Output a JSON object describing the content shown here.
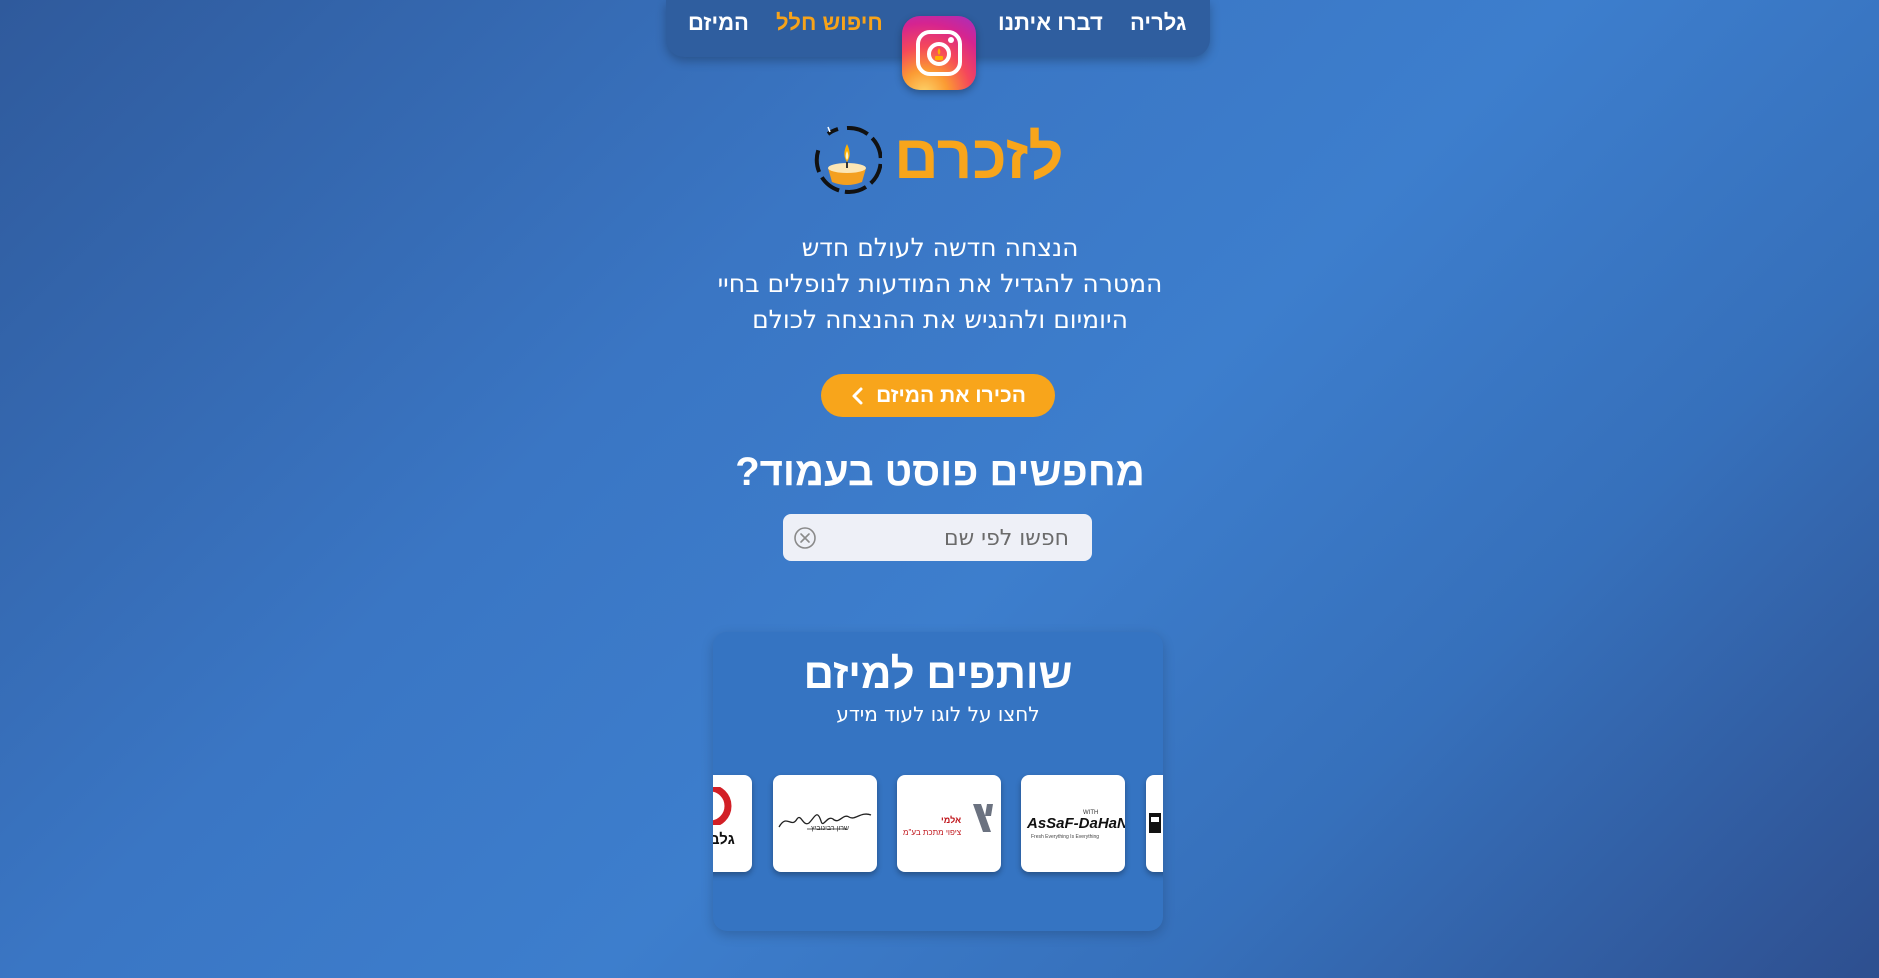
{
  "nav": {
    "gallery": "גלריה",
    "contact": "דברו איתנו",
    "search_fallen": "חיפוש חלל",
    "project": "המיזם",
    "instagram_icon": "instagram-icon"
  },
  "hero": {
    "logo_text": "לזכרם",
    "logo_icon": "memorial-candle-icon",
    "tagline": [
      "הנצחה חדשה לעולם חדש",
      "המטרה להגדיל את המודעות לנופלים בחיי",
      "היומיום ולהנגיש את ההנצחה לכולם"
    ],
    "cta_label": "הכירו את המיזם"
  },
  "search": {
    "heading": "מחפשים פוסט בעמוד?",
    "placeholder": "חפשו לפי שם",
    "value": ""
  },
  "partners": {
    "title": "שותפים למיזם",
    "subtitle": "לחצו על לוגו לעוד מידע",
    "logos": [
      {
        "name": "AsSaF-DaHaN",
        "small": "WITH",
        "tagline": "Fresh Everything Is Everything"
      },
      {
        "name": "אלמי",
        "line2": "ציפוי מתכת בע\"מ"
      },
      {
        "name": "signature",
        "line2": "שרון רבינוביץ"
      },
      {
        "name": "גלב"
      }
    ]
  },
  "colors": {
    "accent": "#f8a51b",
    "nav_bg": "#2f5e9f",
    "card_bg": "#3574c2"
  }
}
